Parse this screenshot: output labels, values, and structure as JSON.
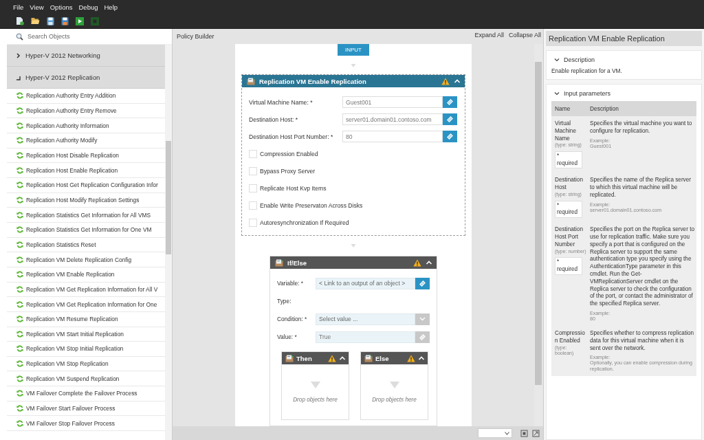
{
  "menu": [
    "File",
    "View",
    "Options",
    "Debug",
    "Help"
  ],
  "search": {
    "placeholder": "Search Objects"
  },
  "tree": [
    {
      "label": "Hyper-V 2012 Networking",
      "expanded": false
    },
    {
      "label": "Hyper-V 2012 Replication",
      "expanded": true,
      "children": [
        {
          "label": "Replication Authority Entry Addition"
        },
        {
          "label": "Replication Authority Entry Remove"
        },
        {
          "label": "Replication Authority Information"
        },
        {
          "label": "Replication Authority Modify"
        },
        {
          "label": "Replication Host Disable Replication"
        },
        {
          "label": "Replication Host Enable Replication"
        },
        {
          "label": "Replication Host Get Replication Configuration Infor"
        },
        {
          "label": "Replication Host Modify Replication Settings"
        },
        {
          "label": "Replication Statistics Get Information for All VMS"
        },
        {
          "label": "Replication Statistics Get Information for One VM"
        },
        {
          "label": "Replication Statistics Reset"
        },
        {
          "label": "Replication VM Delete Replication Config"
        },
        {
          "label": "Replication VM Enable Replication"
        },
        {
          "label": "Replication VM Get Replication Information for All V"
        },
        {
          "label": "Replication VM Get Replication Information for One"
        },
        {
          "label": "Replication VM Resume Replication"
        },
        {
          "label": "Replication VM Start Initial Replication"
        },
        {
          "label": "Replication VM Stop Initial Replication"
        },
        {
          "label": "Replication VM Stop Replication"
        },
        {
          "label": "Replication VM Suspend Replication"
        },
        {
          "label": "VM Failover Complete the Failover Process"
        },
        {
          "label": "VM Failover Start Failover Process"
        },
        {
          "label": "VM Failover Stop Failover Process"
        }
      ]
    }
  ],
  "builder": {
    "title": "Policy Builder",
    "actions": [
      "Expand All",
      "Collapse All"
    ],
    "input_label": "INPUT",
    "activity": {
      "title": "Replication VM Enable Replication",
      "warning": true,
      "expanded": true,
      "fields": [
        {
          "label": "Virtual Machine Name: *",
          "value": "Guest001"
        },
        {
          "label": "Destination Host: *",
          "value": "server01.domain01.contoso.com"
        },
        {
          "label": "Destination Host Port Number: *",
          "value": "80"
        }
      ],
      "options": [
        {
          "label": "Compression Enabled",
          "checked": false
        },
        {
          "label": "Bypass Proxy Server",
          "checked": false
        },
        {
          "label": "Replicate Host Kvp Items",
          "checked": false
        },
        {
          "label": "Enable Write Preservaton Across Disks",
          "checked": false
        },
        {
          "label": "Autoresynchronization If Required",
          "checked": false
        }
      ]
    },
    "if_else": {
      "title": "If/Else",
      "warning": true,
      "expanded": true,
      "fields": [
        {
          "kind": "link",
          "label": "Variable: *",
          "placeholder": "< Link to an output of an object >",
          "disabled": false
        },
        {
          "kind": "text",
          "label": "Type:"
        },
        {
          "kind": "select",
          "label": "Condition: *",
          "placeholder": "Select value ..."
        },
        {
          "kind": "link",
          "label": "Value: *",
          "value": "True",
          "disabled": true
        }
      ],
      "branches": [
        {
          "title": "Then",
          "warning": true,
          "expanded": true,
          "hint": "Drop objects here"
        },
        {
          "title": "Else",
          "warning": true,
          "expanded": true,
          "hint": "Drop objects here"
        }
      ]
    }
  },
  "details": {
    "title": "Replication VM Enable Replication",
    "description": {
      "heading": "Description",
      "expanded": true,
      "text": "Enable replication for a VM."
    },
    "parameters": {
      "heading": "Input parameters",
      "expanded": true,
      "columns": [
        "Name",
        "Description"
      ],
      "rows": [
        {
          "name": "Virtual Machine Name",
          "type": "(type: string)",
          "required": "* required",
          "description": "Specifies the virtual machine you want to configure for replication.",
          "example_label": "Example:",
          "example": "Guest001"
        },
        {
          "name": "Destination Host",
          "type": "(type: string)",
          "required": "* required",
          "description": "Specifies the name of the Replica server to which this virtual machine will be replicated.",
          "example_label": "Example:",
          "example": "server01.domain01.contoso.com"
        },
        {
          "name": "Destination Host Port Number",
          "type": "(type: number)",
          "required": "* required",
          "description": "Specifies the port on the Replica server to use for replication traffic. Make sure you specify a port that is configured on the Replica server to support the same authentication type you specify using the AuthenticationType parameter in this cmdlet. Run the Get-VMReplicationServer cmdlet on the Replica server to check the configuration of the port, or contact the administrator of the specified Replica server.",
          "example_label": "Example:",
          "example": "80"
        },
        {
          "name": "Compression Enabled",
          "type": "(type: boolean)",
          "description": "Specifies whether to compress replication data for this virtual machine when it is sent over the network.",
          "example_label": "Example:",
          "example": "Optionally, you can enable compression during replication."
        }
      ]
    }
  }
}
